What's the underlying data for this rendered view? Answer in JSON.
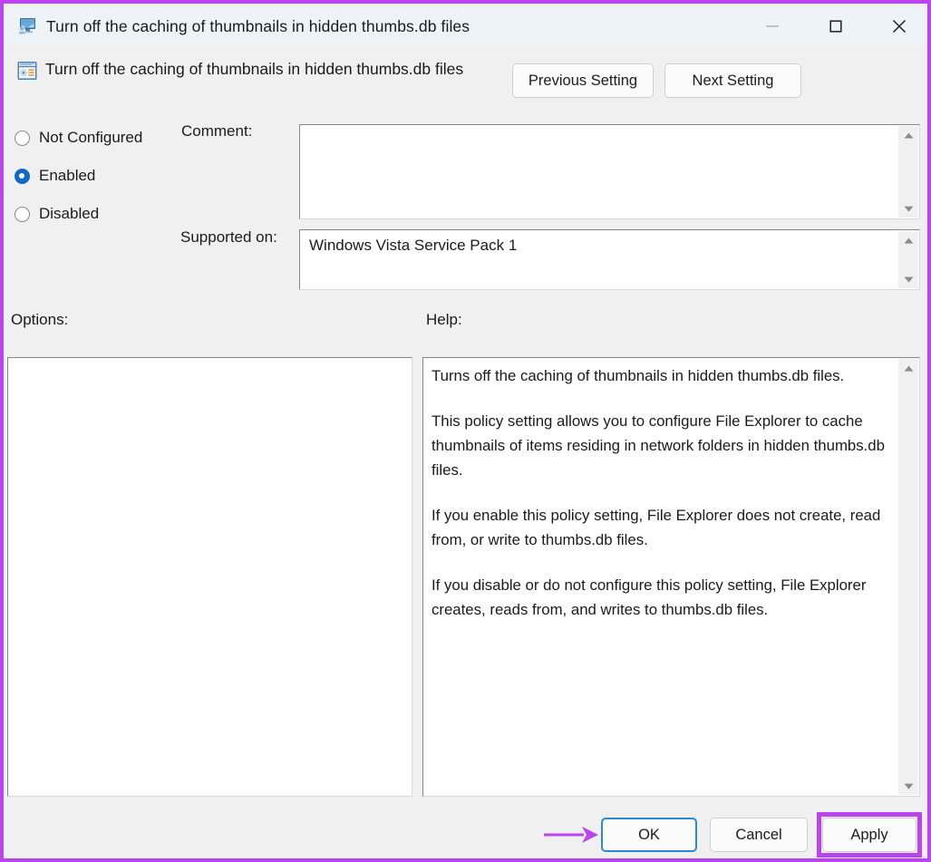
{
  "window": {
    "title": "Turn off the caching of thumbnails in hidden thumbs.db files",
    "title_icon": "policy-computer-icon",
    "minimize_label": "—",
    "maximize_label": "☐",
    "close_label": "✕",
    "border_color": "#bb44f0",
    "titlebar_color": "#eef3f7",
    "body_color": "#f0f0f0"
  },
  "header": {
    "policy_icon": "policy-setting-icon",
    "policy_title": "Turn off the caching of thumbnails in hidden thumbs.db files",
    "previous_setting_label": "Previous Setting",
    "next_setting_label": "Next Setting"
  },
  "state_options": {
    "items": [
      {
        "label": "Not Configured",
        "selected": false
      },
      {
        "label": "Enabled",
        "selected": true
      },
      {
        "label": "Disabled",
        "selected": false
      }
    ],
    "selected_value": "Enabled",
    "selected_color": "#1069c6"
  },
  "comment": {
    "label": "Comment:",
    "value": "",
    "placeholder": ""
  },
  "supported_on": {
    "label": "Supported on:",
    "value": "Windows Vista Service Pack 1"
  },
  "options": {
    "label": "Options:",
    "content": ""
  },
  "help": {
    "label": "Help:",
    "paragraphs": [
      "Turns off the caching of thumbnails in hidden thumbs.db files.",
      "This policy setting allows you to configure File Explorer to cache thumbnails of items residing in network folders in hidden thumbs.db files.",
      "If you enable this policy setting, File Explorer does not create, read from, or write to thumbs.db files.",
      "If you disable or do not configure this policy setting, File Explorer creates, reads from, and writes to thumbs.db files."
    ]
  },
  "scrollbars": {
    "up_arrow_icon": "scroll-up-arrow-icon",
    "down_arrow_icon": "scroll-down-arrow-icon"
  },
  "footer": {
    "ok_label": "OK",
    "cancel_label": "Cancel",
    "apply_label": "Apply",
    "ok_focus_color": "#2b88d8",
    "apply_highlight_color": "#bb44f0",
    "annotation_arrow_color": "#bb44f0",
    "annotation_arrow_icon": "pointing-right-arrow-icon"
  }
}
